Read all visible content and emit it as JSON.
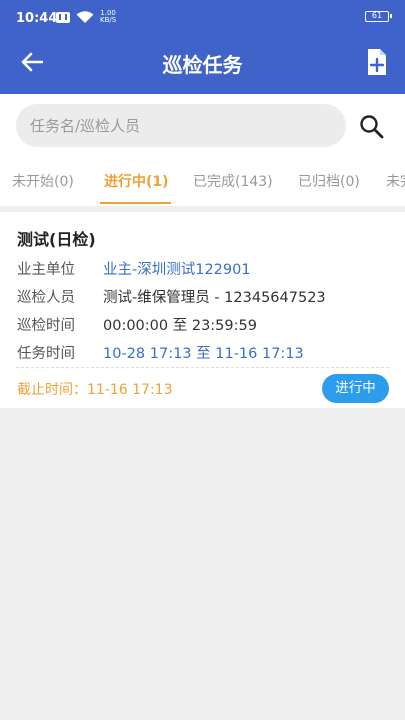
{
  "status_bar": {
    "time": "10:44",
    "speed_value": "1.00",
    "speed_unit": "KB/S",
    "battery": "61"
  },
  "app_bar": {
    "title": "巡检任务",
    "back_icon": "arrow-left-icon",
    "action_icon": "add-file-icon"
  },
  "search": {
    "placeholder": "任务名/巡检人员",
    "value": "",
    "icon": "search-icon"
  },
  "tabs": [
    {
      "label": "未开始(0)",
      "active": false
    },
    {
      "label": "进行中(1)",
      "active": true
    },
    {
      "label": "已完成(143)",
      "active": false
    },
    {
      "label": "已归档(0)",
      "active": false
    },
    {
      "label": "未完",
      "active": false
    }
  ],
  "task": {
    "title": "测试(日检)",
    "fields": [
      {
        "label": "业主单位",
        "value": "业主-深圳测试122901"
      },
      {
        "label": "巡检人员",
        "value": "测试-维保管理员 - 12345647523"
      },
      {
        "label": "巡检时间",
        "value": "00:00:00 至 23:59:59"
      },
      {
        "label": "任务时间",
        "value": "10-28 17:13 至 11-16 17:13"
      }
    ],
    "deadline": "截止时间：11-16 17:13",
    "status": "进行中"
  },
  "colors": {
    "primary": "#3f63c8",
    "accent": "#f0a039",
    "link": "#3a6fc7",
    "status_button": "#2c9cec"
  }
}
